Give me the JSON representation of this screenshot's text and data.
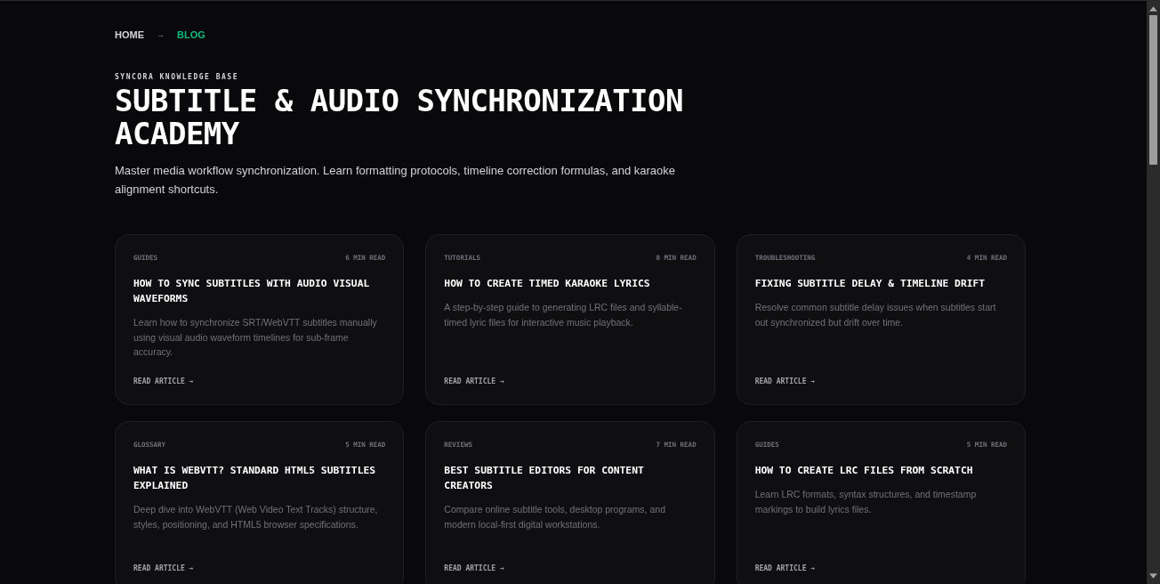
{
  "breadcrumb": {
    "items": [
      {
        "label": "HOME",
        "selected": false
      },
      {
        "label": "BLOG",
        "selected": true
      }
    ],
    "separator": "→"
  },
  "eyebrow": "SYNCORA KNOWLEDGE BASE",
  "title": "SUBTITLE & AUDIO SYNCHRONIZATION ACADEMY",
  "intro": "Master media workflow synchronization. Learn formatting protocols, timeline correction formulas, and karaoke alignment shortcuts.",
  "articles": [
    {
      "category": "GUIDES",
      "read_time": "6 MIN READ",
      "title": "HOW TO SYNC SUBTITLES WITH AUDIO VISUAL WAVEFORMS",
      "summary": "Learn how to synchronize SRT/WebVTT subtitles manually using visual audio waveform timelines for sub-frame accuracy.",
      "link": "READ ARTICLE →"
    },
    {
      "category": "TUTORIALS",
      "read_time": "8 MIN READ",
      "title": "HOW TO CREATE TIMED KARAOKE LYRICS",
      "summary": "A step-by-step guide to generating LRC files and syllable-timed lyric files for interactive music playback.",
      "link": "READ ARTICLE →"
    },
    {
      "category": "TROUBLESHOOTING",
      "read_time": "4 MIN READ",
      "title": "FIXING SUBTITLE DELAY & TIMELINE DRIFT",
      "summary": "Resolve common subtitle delay issues when subtitles start out synchronized but drift over time.",
      "link": "READ ARTICLE →"
    },
    {
      "category": "GLOSSARY",
      "read_time": "5 MIN READ",
      "title": "WHAT IS WEBVTT? STANDARD HTML5 SUBTITLES EXPLAINED",
      "summary": "Deep dive into WebVTT (Web Video Text Tracks) structure, styles, positioning, and HTML5 browser specifications.",
      "link": "READ ARTICLE →"
    },
    {
      "category": "REVIEWS",
      "read_time": "7 MIN READ",
      "title": "BEST SUBTITLE EDITORS FOR CONTENT CREATORS",
      "summary": "Compare online subtitle tools, desktop programs, and modern local-first digital workstations.",
      "link": "READ ARTICLE →"
    },
    {
      "category": "GUIDES",
      "read_time": "5 MIN READ",
      "title": "HOW TO CREATE LRC FILES FROM SCRATCH",
      "summary": "Learn LRC formats, syntax structures, and timestamp markings to build lyrics files.",
      "link": "READ ARTICLE →"
    }
  ]
}
